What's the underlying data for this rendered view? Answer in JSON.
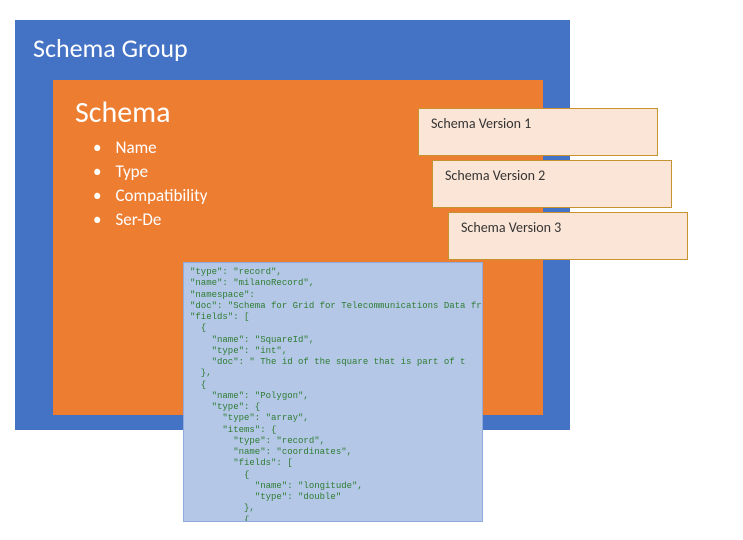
{
  "schemaGroup": {
    "title": "Schema Group"
  },
  "schema": {
    "title": "Schema",
    "items": [
      "Name",
      "Type",
      "Compatibility",
      "Ser-De"
    ]
  },
  "versions": {
    "v1": "Schema Version 1",
    "v2": "Schema Version 2",
    "v3": "Schema Version 3"
  },
  "code": "\"type\": \"record\",\n\"name\": \"milanoRecord\",\n\"namespace\":\n\"doc\": \"Schema for Grid for Telecommunications Data from Tel\n\"fields\": [\n  {\n    \"name\": \"SquareId\",\n    \"type\": \"int\",\n    \"doc\": \" The id of the square that is part of t\n  },\n  {\n    \"name\": \"Polygon\",\n    \"type\": {\n      \"type\": \"array\",\n      \"items\": {\n        \"type\": \"record\",\n        \"name\": \"coordinates\",\n        \"fields\": [\n          {\n            \"name\": \"longitude\",\n            \"type\": \"double\"\n          },\n          {\n            \"name\": \"latitude\",\n            \"type\": \"double\"\n          }\n        ]\n      }\n    }\n  }\n]"
}
